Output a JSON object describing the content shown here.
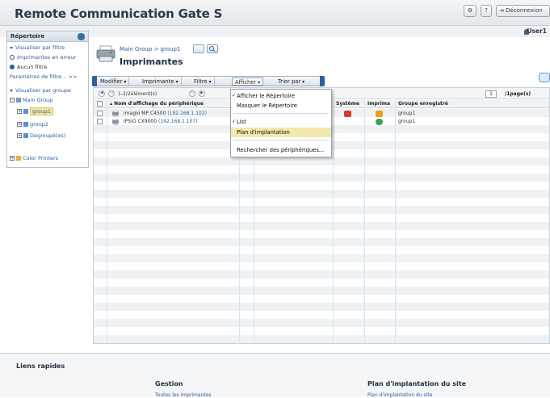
{
  "app": {
    "title": "Remote Communication Gate S",
    "header_buttons": [
      "⚙",
      "?",
      "⇥ Déconnexion"
    ],
    "user": "User1"
  },
  "sidebar": {
    "title": "Répertoire",
    "filter_view": "Visualiser par filtre",
    "filters": [
      {
        "label": "Imprimantes en erreur",
        "selected": false
      },
      {
        "label": "Aucun filtre",
        "selected": true
      }
    ],
    "filter_settings": "Paramètres de filtre...",
    "group_view": "Visualiser par groupe",
    "tree": {
      "root": "Main Group",
      "children": [
        "group1",
        "group2",
        "Dégroupé(es)"
      ],
      "other": "Color Printers"
    }
  },
  "main": {
    "breadcrumb": "Main Group > group1",
    "title": "Imprimantes",
    "toolbar": [
      "Modifier",
      "Imprimante",
      "Filtre",
      "Afficher",
      "Trier par"
    ],
    "pager": {
      "range": "1-2/2élément(s)",
      "page": "1",
      "per_page": "/1page(s)"
    },
    "columns": [
      "Nom d'affichage du périphérique",
      "Système",
      "Imprima",
      "Groupe enregistré"
    ],
    "rows": [
      {
        "name": "imagio MP C4500",
        "ip": "(192.168.1.102)",
        "group": "group1",
        "system": "error",
        "printer": "warning"
      },
      {
        "name": "IPSiO CX9000",
        "ip": "(192.168.1.107)",
        "group": "group1",
        "system": "none",
        "printer": "ok"
      }
    ],
    "status_colors": {
      "error": "#d63b2f",
      "warning": "#e6a21a",
      "ok": "#3aa24a"
    }
  },
  "dropdown": {
    "items": [
      {
        "label": "Afficher le Répertoire",
        "checked": true
      },
      {
        "label": "Masquer le Répertoire",
        "checked": false
      },
      {
        "label": "List",
        "checked": true
      },
      {
        "label": "Plan d'implantation",
        "checked": false,
        "highlighted": true
      },
      {
        "label": "Rechercher des périphériques...",
        "checked": false
      }
    ]
  },
  "footer": {
    "title": "Liens rapides",
    "sections": [
      {
        "heading": "Gestion",
        "link": "Toutes les imprimantes"
      },
      {
        "heading": "Plan d'implantation du site",
        "link": "Plan d'implantation du site"
      }
    ]
  }
}
